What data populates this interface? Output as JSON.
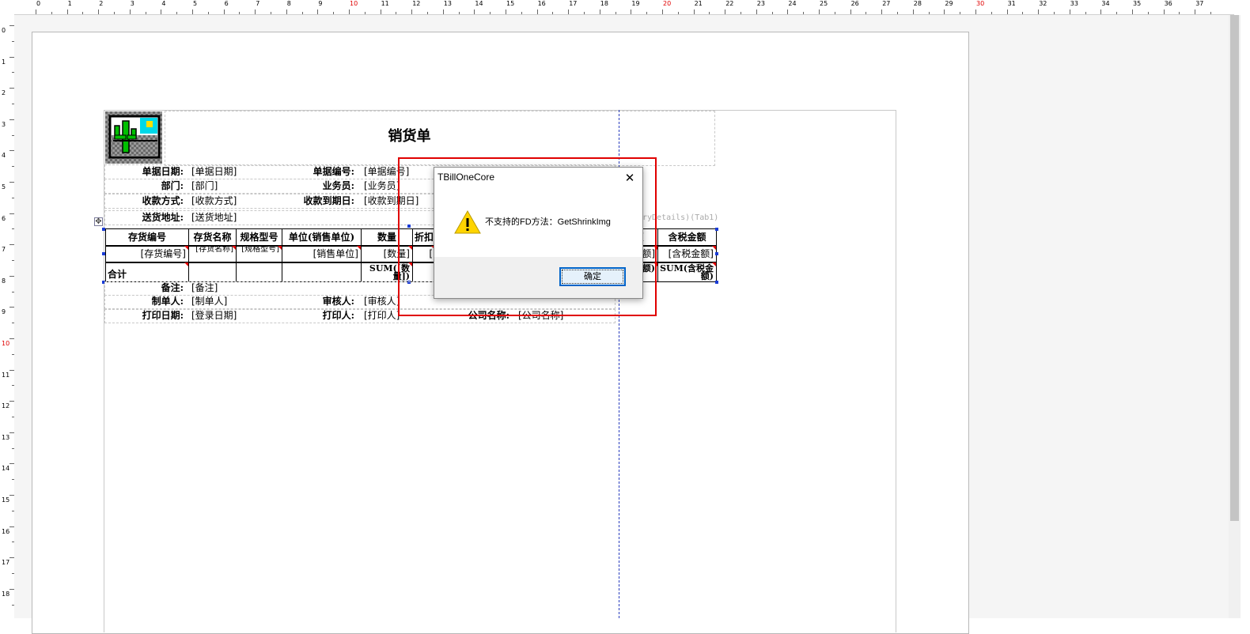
{
  "rulers": {
    "horizontal_numbers": [
      "0",
      "1",
      "2",
      "3",
      "4",
      "5",
      "6",
      "7",
      "8",
      "9",
      "10",
      "11",
      "12",
      "13",
      "14",
      "15",
      "16",
      "17",
      "18",
      "19",
      "20",
      "21",
      "22",
      "23",
      "24",
      "25",
      "26",
      "27",
      "28",
      "29",
      "30",
      "31",
      "32",
      "33",
      "34",
      "35",
      "36",
      "37"
    ],
    "vertical_numbers": [
      "0",
      "1",
      "2",
      "3",
      "4",
      "5",
      "6",
      "7",
      "8",
      "9",
      "10",
      "11",
      "12",
      "13",
      "14",
      "15",
      "16",
      "17",
      "18"
    ]
  },
  "report": {
    "title": "销货单",
    "header_rows": [
      {
        "label1": "单据日期:",
        "field1": "[单据日期]",
        "label2": "单据编号:",
        "field2": "[单据编号]"
      },
      {
        "label1": "部门:",
        "field1": "[部门]",
        "label2": "业务员:",
        "field2": "[业务员]"
      },
      {
        "label1": "收款方式:",
        "field1": "[收款方式]",
        "label2": "收款到期日:",
        "field2": "[收款到期日]"
      },
      {
        "label1": "送货地址:",
        "field1": "[送货地址]"
      }
    ],
    "table_source_label": "ryDetails)(Tab1)",
    "table": {
      "headers": [
        "存货编号",
        "存货名称",
        "规格型号",
        "单位(销售单位)",
        "数量",
        "折扣",
        "额",
        "含税金额"
      ],
      "detail_row": [
        "[存货编号]",
        "[存货名称]",
        "[规格型号]",
        "[销售单位]",
        "[数量]",
        "[",
        "额]",
        "[含税金额]"
      ],
      "total_row": [
        "合计",
        "",
        "",
        "",
        "SUM([数量])",
        "",
        "税额)",
        "SUM(含税金额)"
      ]
    },
    "footer_rows": [
      {
        "label1": "备注:",
        "field1": "[备注]"
      },
      {
        "label1": "制单人:",
        "field1": "[制单人]",
        "label2": "审核人:",
        "field2": "[审核人]"
      },
      {
        "label1": "打印日期:",
        "field1": "[登录日期]",
        "label2": "打印人:",
        "field2": "[打印人]",
        "label3": "公司名称:",
        "field3": "[公司名称]"
      }
    ]
  },
  "dialog": {
    "title": "TBillOneCore",
    "message": "不支持的FD方法：GetShrinkImg",
    "ok_label": "确定",
    "icon": "warning-icon",
    "close_icon": "close-icon"
  },
  "colors": {
    "highlight_box": "#e00000",
    "selection_handle": "#1a3cd6",
    "default_button_border": "#0063c8"
  }
}
